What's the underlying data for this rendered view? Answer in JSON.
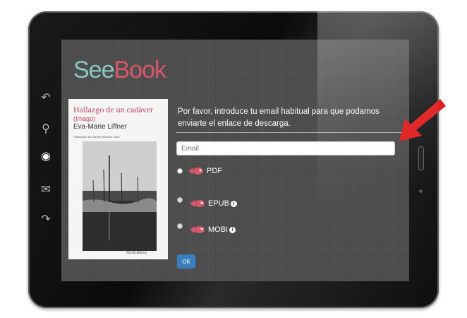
{
  "logo": {
    "see": "See",
    "book": "Book"
  },
  "book": {
    "title": "Hallazgo de un cadáver",
    "subtitle": "(Imago)",
    "author": "Eva-Marie Liffner",
    "translation": "Traducción de Carmen Montes Cano",
    "publisher": "Nordicalibros"
  },
  "form": {
    "prompt": "Por favor, introduce tu email habitual para que podamos enviarte el enlace de descarga.",
    "email_placeholder": "Email",
    "options": [
      {
        "label": "PDF",
        "info": false
      },
      {
        "label": "EPUB",
        "info": true
      },
      {
        "label": "MOBI",
        "info": true
      }
    ],
    "info_glyph": "i",
    "ok_label": "OK"
  },
  "colors": {
    "accent": "#d9576a",
    "logo_teal": "#8cc7c3",
    "ok_button": "#3b7ec0",
    "arrow": "#e02020"
  },
  "icons": [
    "back-icon",
    "search-icon",
    "seebook-icon",
    "mail-icon",
    "forward-icon"
  ]
}
